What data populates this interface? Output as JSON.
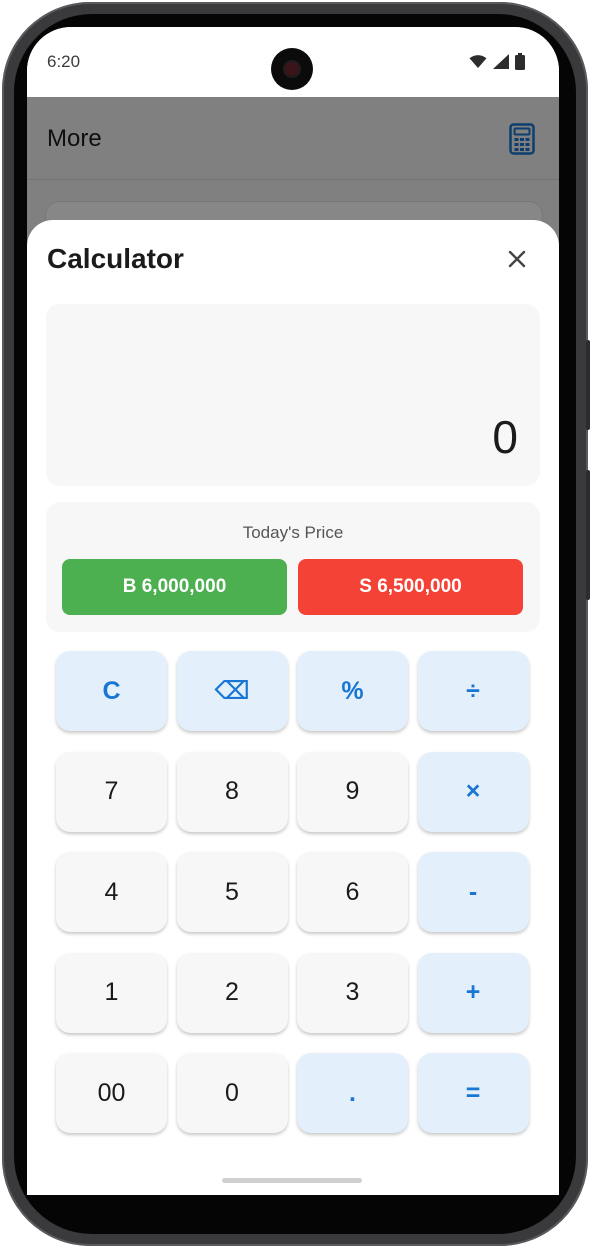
{
  "status_bar": {
    "time": "6:20",
    "icons": [
      "wifi-icon",
      "signal-icon",
      "battery-icon"
    ]
  },
  "app_bar": {
    "title": "More",
    "action_icon": "calculator-icon"
  },
  "calculator": {
    "title": "Calculator",
    "close_icon": "close-icon",
    "display_value": "0",
    "price": {
      "label": "Today's Price",
      "buy": "B 6,000,000",
      "sell": "S 6,500,000"
    },
    "keys": [
      {
        "label": "C",
        "type": "op",
        "name": "clear-key"
      },
      {
        "label": "⌫",
        "type": "op",
        "name": "backspace-key"
      },
      {
        "label": "%",
        "type": "op",
        "name": "percent-key"
      },
      {
        "label": "÷",
        "type": "op",
        "name": "divide-key"
      },
      {
        "label": "7",
        "type": "num",
        "name": "digit-7-key"
      },
      {
        "label": "8",
        "type": "num",
        "name": "digit-8-key"
      },
      {
        "label": "9",
        "type": "num",
        "name": "digit-9-key"
      },
      {
        "label": "×",
        "type": "op",
        "name": "multiply-key"
      },
      {
        "label": "4",
        "type": "num",
        "name": "digit-4-key"
      },
      {
        "label": "5",
        "type": "num",
        "name": "digit-5-key"
      },
      {
        "label": "6",
        "type": "num",
        "name": "digit-6-key"
      },
      {
        "label": "-",
        "type": "op",
        "name": "subtract-key"
      },
      {
        "label": "1",
        "type": "num",
        "name": "digit-1-key"
      },
      {
        "label": "2",
        "type": "num",
        "name": "digit-2-key"
      },
      {
        "label": "3",
        "type": "num",
        "name": "digit-3-key"
      },
      {
        "label": "+",
        "type": "op",
        "name": "add-key"
      },
      {
        "label": "00",
        "type": "num",
        "name": "double-zero-key"
      },
      {
        "label": "0",
        "type": "num",
        "name": "digit-0-key"
      },
      {
        "label": ".",
        "type": "op",
        "name": "decimal-key"
      },
      {
        "label": "=",
        "type": "op",
        "name": "equals-key"
      }
    ]
  },
  "colors": {
    "buy": "#4caf50",
    "sell": "#f44336",
    "accent": "#1976d2",
    "op_key_bg": "#e3f0fc"
  }
}
